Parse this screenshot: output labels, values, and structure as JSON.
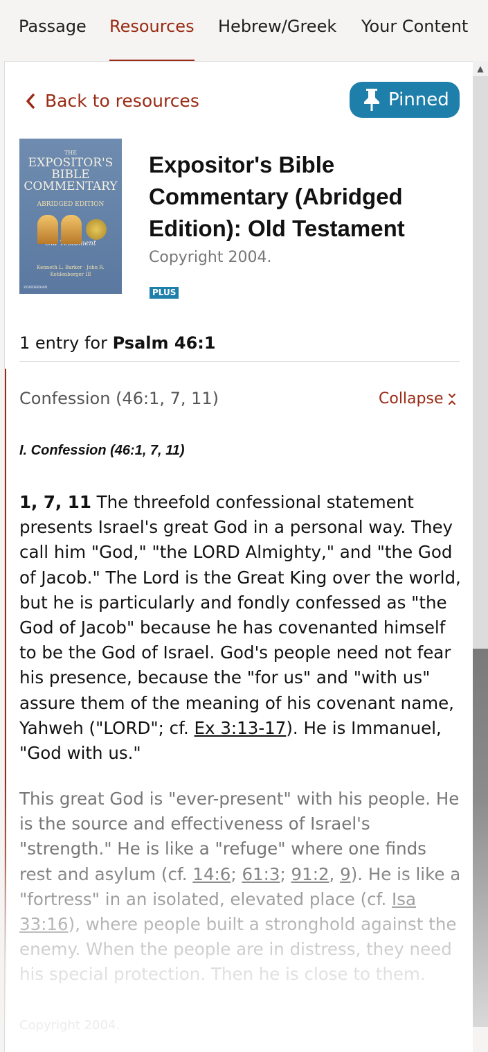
{
  "tabs": [
    {
      "label": "Passage"
    },
    {
      "label": "Resources"
    },
    {
      "label": "Hebrew/Greek"
    },
    {
      "label": "Your Content"
    }
  ],
  "active_tab": "Resources",
  "back_link": "Back to resources",
  "pinned_button": "Pinned",
  "resource": {
    "cover": {
      "top": "THE",
      "title": "EXPOSITOR'S BIBLE COMMENTARY",
      "edition": "ABRIDGED EDITION",
      "testament": "Old Testament",
      "authors": "Kenneth L. Barker · John R. Kohlenberger III",
      "publisher": "ZONDERVAN"
    },
    "title": "Expositor's Bible Commentary (Abridged Edition): Old Testament",
    "copyright": "Copyright 2004.",
    "badge": "PLUS"
  },
  "entry_count": {
    "prefix": "1 entry for ",
    "passage": "Psalm 46:1"
  },
  "section": {
    "title": "Confession (46:1, 7, 11)",
    "collapse_label": "Collapse",
    "heading": "I. Confession (46:1, 7, 11)",
    "para1_lead": "1, 7, 11",
    "para1_text": " The threefold confessional statement presents Israel's great God in a personal way. They call him \"God,\" \"the LORD Almighty,\" and \"the God of Jacob.\" The Lord is the Great King over the world, but he is particularly and fondly confessed as \"the God of Jacob\" because he has covenanted himself to be the God of Israel. God's people need not fear his presence, because the \"for us\" and \"with us\" assure them of the meaning of his covenant name, Yahweh (\"LORD\"; cf. ",
    "para1_ref": "Ex 3:13-17",
    "para1_tail": "). He is Immanuel, \"God with us.\"",
    "para2_a": "This great God is \"ever-present\" with his people. He is the source and effectiveness of Israel's \"strength.\" He is like a \"refuge\" where one finds rest and asylum (cf. ",
    "para2_ref1": "14:6",
    "para2_sep1": "; ",
    "para2_ref2": "61:3",
    "para2_sep2": "; ",
    "para2_ref3": "91:2",
    "para2_sep3": ", ",
    "para2_ref4": "9",
    "para2_b": "). He is like a \"fortress\" in an isolated, elevated place (cf. ",
    "para2_ref5": "Isa 33:16",
    "para2_c": "), where people built a stronghold against the enemy. When the people are in distress, they need his special protection. Then he is close to them.",
    "footer_copyright": "Copyright 2004."
  },
  "colors": {
    "accent": "#9a2a14",
    "pinned_bg": "#1f7fab"
  }
}
